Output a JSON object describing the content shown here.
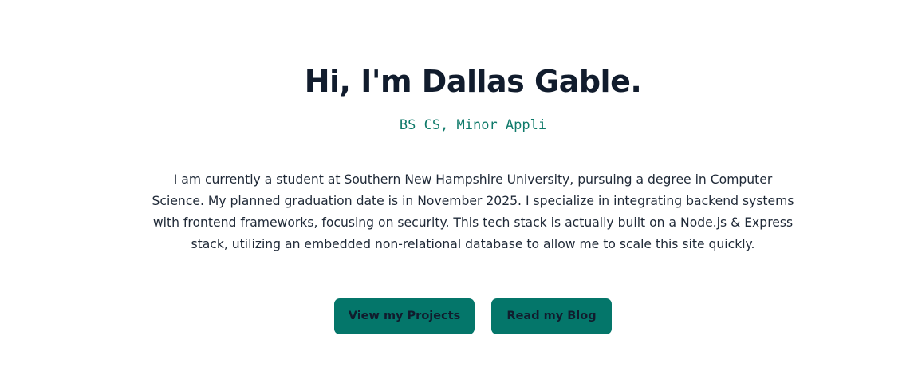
{
  "hero": {
    "headline": "Hi, I'm Dallas Gable.",
    "subtitle": "BS CS, Minor Appli",
    "bio": "I am currently a student at Southern New Hampshire University, pursuing a degree in Computer Science. My planned graduation date is in November 2025. I specialize in integrating backend systems with frontend frameworks, focusing on security. This tech stack is actually built on a Node.js & Express stack, utilizing an embedded non-relational database to allow me to scale this site quickly."
  },
  "actions": {
    "projects_label": "View my Projects",
    "blog_label": "Read my Blog"
  },
  "colors": {
    "accent": "#04766a",
    "subtitle": "#0f7a6a",
    "heading": "#111c2d"
  }
}
